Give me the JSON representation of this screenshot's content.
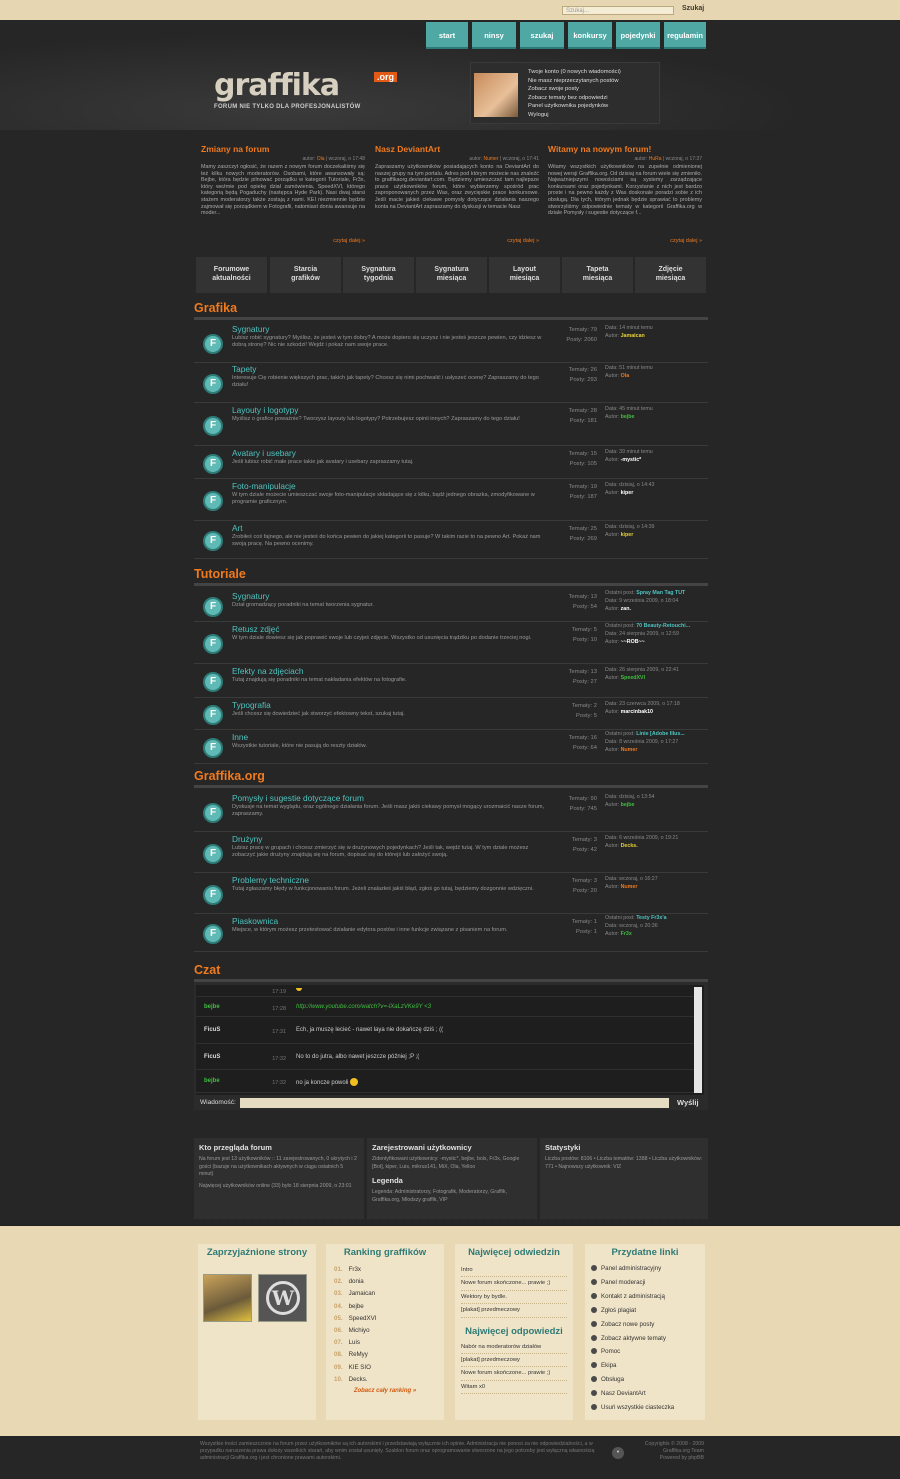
{
  "search": {
    "placeholder": "Szukaj...",
    "button": "Szukaj"
  },
  "nav": [
    "start",
    "ninsy",
    "szukaj",
    "konkursy",
    "pojedynki",
    "regulamin"
  ],
  "logo": {
    "text": "graffika",
    "org": ".org",
    "tagline": "FORUM NIE TYLKO DLA PROFESJONALISTÓW"
  },
  "user_links": [
    "Twoje konto (0 nowych wiadomości)",
    "Nie masz nieprzeczytanych postów",
    "Zobacz swoje posty",
    "Zobacz tematy bez odpowiedzi",
    "Panel użytkownika pojedynków",
    "Wyloguj"
  ],
  "news": [
    {
      "title": "Zmiany na forum",
      "meta_pre": "autor:",
      "author": "Ola",
      "meta_post": "| wczoraj, o 17:48",
      "body": "Mamy zaszczyt ogłosić, że razem z nowym forum doczekaliśmy się też kilku nowych moderatorów. Osobami, które awansowały są: Bejbe, która będzie pilnować porządku w kategorii Tutoriale, Fr3x, który weźmie pod opiekę dział zamówienia, SpeedXVI, którego kategorią będą Pogaduchy (następca Hyde Park). Nasi dwaj starsi stażem moderatorzy także zostają z nami. KEI niezmiennie będzie zajmował się porządkiem w Fotografii, natomiast donia awansuje na moder...",
      "more": "czytaj dalej »"
    },
    {
      "title": "Nasz DeviantArt",
      "meta_pre": "autor:",
      "author": "Numer",
      "meta_post": "| wczoraj, o 17:41",
      "body": "Zapraszamy użytkowników posiadających konto na DeviantArt do naszej grupy na tym portalu. Adres pod którym możecie nas znaleźć to graffikaorg.deviantart.com. Będziemy umieszczać tam najlepsze prace użytkowników forum, które wybierzemy spośród prac zaproponowanych przez Was, oraz zwycięskie prace konkursowe. Jeśli macie jakieś ciekawe pomysły dotyczące działania naszego konta na DeviantArt zapraszamy do dyskusji w temacie Nasz",
      "more": "czytaj dalej »"
    },
    {
      "title": "Witamy na nowym forum!",
      "meta_pre": "autor:",
      "author": "HuRa",
      "meta_post": "| wczoraj, o 17:37",
      "body": "Witamy wszystkich użytkowników na zupełnie odmienionej nowej wersji Graffika.org. Od dzisiaj na forum wiele się zmieniło. Najważniejszymi nowościami są systemy zarządzające konkursami oraz pojedynkami. Korzystanie z nich jest bardzo proste i na pewno każdy z Was doskonale poradzi sobie z ich obsługą. Dla tych, którym jednak będzie sprawiać to problemy stworzyliśmy odpowiednie tematy w kategorii Graffika.org w dziale Pomysły i sugestie dotyczące f...",
      "more": "czytaj dalej »"
    }
  ],
  "tabs": [
    [
      "Forumowe",
      "aktualności"
    ],
    [
      "Starcia",
      "grafików"
    ],
    [
      "Sygnatura",
      "tygodnia"
    ],
    [
      "Sygnatura",
      "miesiąca"
    ],
    [
      "Layout",
      "miesiąca"
    ],
    [
      "Tapeta",
      "miesiąca"
    ],
    [
      "Zdjęcie",
      "miesiąca"
    ]
  ],
  "sections": [
    {
      "title": "Grafika",
      "forums": [
        {
          "name": "Sygnatury",
          "desc": "Lubisz robić sygnatury? Myślisz, że jesteś w tym dobry? A może dopiero się uczysz i nie jesteś jeszcze pewien, czy idziesz w dobrą stronę? Nic nie szkodzi! Wejdź i pokaż nam swoje prace.",
          "tematy": "Tematy: 79",
          "posty": "Posty: 2060",
          "l1": "",
          "l1v": "",
          "l2": "Data: 14 minut temu",
          "l3": "Autor: ",
          "author": "Jamaican",
          "ac": "y"
        },
        {
          "name": "Tapety",
          "desc": "Interesuje Cię robienie większych prac, takich jak tapety? Chcesz się nimi pochwalić i usłyszeć ocenę? Zapraszamy do tego działu!",
          "tematy": "Tematy: 26",
          "posty": "Posty: 293",
          "l1": "",
          "l1v": "",
          "l2": "Data: 51 minut temu",
          "l3": "Autor: ",
          "author": "Ola",
          "ac": "o"
        },
        {
          "name": "Layouty i logotypy",
          "desc": "Myślisz o grafice poważnie? Tworzysz layouty lub logotypy? Potrzebujesz opinii innych? Zapraszamy do tego działu!",
          "tematy": "Tematy: 28",
          "posty": "Posty: 181",
          "l1": "",
          "l1v": "",
          "l2": "Data: 45 minut temu",
          "l3": "Autor: ",
          "author": "bejbe",
          "ac": "g"
        },
        {
          "name": "Avatary i usebary",
          "desc": "Jeśli lubisz robić małe prace takie jak avatary i usebary zapraszamy tutaj.",
          "tematy": "Tematy: 15",
          "posty": "Posty: 105",
          "l1": "",
          "l1v": "",
          "l2": "Data: 39 minut temu",
          "l3": "Autor: ",
          "author": "-mystic*",
          "ac": "w"
        },
        {
          "name": "Foto-manipulacje",
          "desc": "W tym dziale możecie umieszczać swoje foto-manipulacje składające się z kilku, bądź jednego obrazka, zmodyfikowane w programie graficznym.",
          "tematy": "Tematy: 19",
          "posty": "Posty: 187",
          "l1": "",
          "l1v": "",
          "l2": "Data: dzisiaj, o 14:43",
          "l3": "Autor: ",
          "author": "kiper",
          "ac": "w"
        },
        {
          "name": "Art",
          "desc": "Zrobiłeś coś fajnego, ale nie jesteś do końca pewien do jakiej kategorii to pasuje? W takim razie to na pewno Art. Pokaż nam swoją pracę. Na pewno ocenimy.",
          "tematy": "Tematy: 25",
          "posty": "Posty: 269",
          "l1": "",
          "l1v": "",
          "l2": "Data: dzisiaj, o 14:39",
          "l3": "Autor: ",
          "author": "kiper",
          "ac": "y"
        }
      ]
    },
    {
      "title": "Tutoriale",
      "forums": [
        {
          "name": "Sygnatury",
          "desc": "Dział gromadzący poradniki na temat tworzenia sygnatur.",
          "tematy": "Tematy: 13",
          "posty": "Posty: 54",
          "l1": "Ostatni post: ",
          "l1v": "Spray Man Tag TUT",
          "l2": "Data: 9 września 2009, o 18:04",
          "l3": "Autor: ",
          "author": "zan.",
          "ac": "w"
        },
        {
          "name": "Retusz zdjęć",
          "desc": "W tym dziale dowiesz się jak poprawić swoje lub czyjeś zdjęcie. Wszystko od usunięcia trądziku po dodanie trzeciej nogi.",
          "tematy": "Tematy: 5",
          "posty": "Posty: 10",
          "l1": "Ostatni post: ",
          "l1v": "70 Beauty-Retouchi...",
          "l2": "Data: 24 sierpnia 2009, o 12:59",
          "l3": "Autor: ",
          "author": "~~ROB~~",
          "ac": "w"
        },
        {
          "name": "Efekty na zdjęciach",
          "desc": "Tutaj znajdują się poradniki na temat nakładania efektów na fotografie.",
          "tematy": "Tematy: 13",
          "posty": "Posty: 27",
          "l1": "",
          "l1v": "",
          "l2": "Data: 26 sierpnia 2009, o 22:41",
          "l3": "Autor: ",
          "author": "SpeedXVI",
          "ac": "g"
        },
        {
          "name": "Typografia",
          "desc": "Jeśli chcesz się dowiedzieć jak stworzyć efektowny tekst, szukaj tutaj.",
          "tematy": "Tematy: 2",
          "posty": "Posty: 5",
          "l1": "",
          "l1v": "",
          "l2": "Data: 23 czerwca 2009, o 17:18",
          "l3": "Autor: ",
          "author": "marcinbak10",
          "ac": "w"
        },
        {
          "name": "Inne",
          "desc": "Wszystkie tutoriale, które nie pasują do reszty działów.",
          "tematy": "Tematy: 16",
          "posty": "Posty: 64",
          "l1": "Ostatni post: ",
          "l1v": "Linie [Adobe Illus...",
          "l2": "Data: 8 września 2009, o 17:27",
          "l3": "Autor: ",
          "author": "Numer",
          "ac": "o"
        }
      ]
    },
    {
      "title": "Graffika.org",
      "forums": [
        {
          "name": "Pomysły i sugestie dotyczące forum",
          "desc": "Dyskusje na temat wyglądu, oraz ogólnego działania forum. Jeśli masz jakiś ciekawy pomysł mogący urozmaicić nasze forum, zapraszamy.",
          "tematy": "Tematy: 90",
          "posty": "Posty: 745",
          "l1": "",
          "l1v": "",
          "l2": "Data: dzisiaj, o 13:54",
          "l3": "Autor: ",
          "author": "bejbe",
          "ac": "g"
        },
        {
          "name": "Drużyny",
          "desc": "Lubisz pracę w grupach i chcesz zmierzyć się w drużynowych pojedynkach? Jeśli tak, wejdź tutaj. W tym dziale możesz zobaczyć jakie drużyny znajdują się na forum, dopisać się do którejś lub założyć swoją.",
          "tematy": "Tematy: 3",
          "posty": "Posty: 42",
          "l1": "",
          "l1v": "",
          "l2": "Data: 6 września 2009, o 19:21",
          "l3": "Autor: ",
          "author": "Decks.",
          "ac": "y"
        },
        {
          "name": "Problemy techniczne",
          "desc": "Tutaj zgłaszamy błędy w funkcjonowaniu forum. Jeżeli znalazłeś jakiś błąd, zgłoś go tutaj, będziemy dozgonnie wdzięczni.",
          "tematy": "Tematy: 3",
          "posty": "Posty: 20",
          "l1": "",
          "l1v": "",
          "l2": "Data: wczoraj, o 16:27",
          "l3": "Autor: ",
          "author": "Numer",
          "ac": "o"
        },
        {
          "name": "Piaskownica",
          "desc": "Miejsce, w którym możesz przetestować działanie edytora postów i inne funkcje związane z pisaniem na forum.",
          "tematy": "Tematy: 1",
          "posty": "Posty: 1",
          "l1": "Ostatni post: ",
          "l1v": "Testy Fr3x'a",
          "l2": "Data: wczoraj, o 20:36",
          "l3": "Autor: ",
          "author": "Fr3x",
          "ac": "g"
        }
      ]
    }
  ],
  "chat": {
    "title": "Czat",
    "rows": [
      {
        "name": "",
        "time": "17:19",
        "msg": "",
        "nc": "w"
      },
      {
        "name": "bejbe",
        "time": "17:28",
        "msg": "http://www.youtube.com/watch?v=-lXaLzVKe9Y <3",
        "nc": "g"
      },
      {
        "name": "FicuS",
        "time": "17:31",
        "msg": "Ech, ja muszę lecieć - nawet laya nie dokańczę dziś ; ((",
        "nc": "w"
      },
      {
        "name": "FicuS",
        "time": "17:32",
        "msg": "No to do jutra, albo nawet jeszcze później ;P ;(",
        "nc": "w"
      },
      {
        "name": "bejbe",
        "time": "17:32",
        "msg": "no ja koncze powoli",
        "nc": "g"
      }
    ],
    "label": "Wiadomość:",
    "send": "Wyślij"
  },
  "stats": [
    {
      "title": "Kto przegląda forum",
      "text": "Na forum jest 13 użytkowników :: 11 zarejestrowanych, 0 ukrytych i 2 gości (bazuje na użytkownikach aktywnych w ciągu ostatnich 5 minut)",
      "text2": "Najwięcej użytkowników online (33) było 18 sierpnia 2009, o 23:01"
    },
    {
      "title": "Zarejestrowani użytkownicy",
      "text": "Zidentyfikowani użytkownicy: -mystic*, bejbe, bols, Fr3x, Google [Bot], kiper, Luis, mikrus141, MiX, Ola, Yelloo",
      "title2": "Legenda",
      "text2": "Legenda: Administratorzy, Fotografik, Moderatorzy, Graffik, Graffika.org, Młodszy graffik, VIP"
    },
    {
      "title": "Statystyki",
      "text": "Liczba postów: 8106 • Liczba tematów: 1388 • Liczba użytkowników: 771 • Najnowszy użytkownik: VIZ"
    }
  ],
  "friends": {
    "title": "Zaprzyjaźnione strony"
  },
  "ranking": {
    "title": "Ranking graffików",
    "items": [
      [
        "01.",
        "Fr3x"
      ],
      [
        "02.",
        "donia"
      ],
      [
        "03.",
        "Jamaican"
      ],
      [
        "04.",
        "bejbe"
      ],
      [
        "05.",
        "SpeedXVI"
      ],
      [
        "06.",
        "Michiyo"
      ],
      [
        "07.",
        "Luis"
      ],
      [
        "08.",
        "ReMyy"
      ],
      [
        "09.",
        "KIE SIO"
      ],
      [
        "10.",
        "Decks."
      ]
    ],
    "more": "Zobacz cały ranking »"
  },
  "visited": {
    "title": "Najwięcej odwiedzin",
    "items": [
      "Intro",
      "Nowe forum skończone... prawie ;)",
      "Wektory by bydle.",
      "[plakat] przedmeczowy"
    ]
  },
  "replies": {
    "title": "Najwięcej odpowiedzi",
    "items": [
      "Nabór na moderatorów działów",
      "[plakat] przedmeczowy",
      "Nowe forum skończone... prawie ;)",
      "Witam x0"
    ]
  },
  "useful": {
    "title": "Przydatne linki",
    "items": [
      "Panel administracyjny",
      "Panel moderacji",
      "Kontakt z administracją",
      "Zgłoś plagiat",
      "Zobacz nowe posty",
      "Zobacz aktywne tematy",
      "Pomoc",
      "Ekipa",
      "Obsługa",
      "Nasz DeviantArt",
      "Usuń wszystkie ciasteczka"
    ]
  },
  "footer": {
    "left": "Wszystkie treści zamieszczone na forum przez użytkowników są ich autorskimi i przedstawiają wyłącznie ich opinie. Administracja nie ponosi za nie odpowiedzialności, a w przypadku naruszenia prawa dołoży wszelkich starań, aby wnim został usunięty. Szablon forum oraz oprogramowanie stworzone na jego potrzeby jest wyłączną własnością administracji Graffika.org i jest chronione prawami autorskimi.",
    "right1": "Copyrights © 2008 - 2009",
    "right2": "Graffika.org Team",
    "right3": "Powered by phpBB"
  },
  "colors": {
    "accent": "#f07a1e",
    "teal": "#4fa8a4",
    "link": "#4ec4c0"
  }
}
